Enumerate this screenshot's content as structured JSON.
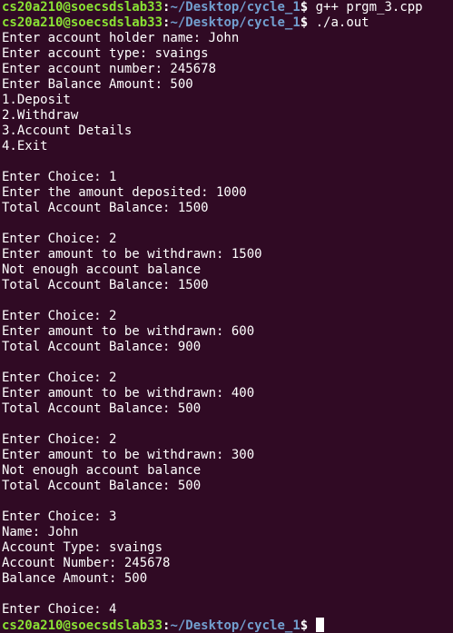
{
  "prompt": {
    "user_host": "cs20a210@soecsdslab33",
    "colon": ":",
    "path": "~/Desktop/cycle_1",
    "symbol": "$ "
  },
  "commands": [
    "g++ prgm_3.cpp",
    "./a.out"
  ],
  "output_lines": [
    "Enter account holder name: John",
    "Enter account type: svaings",
    "Enter account number: 245678",
    "Enter Balance Amount: 500",
    "1.Deposit",
    "2.Withdraw",
    "3.Account Details",
    "4.Exit",
    "",
    "Enter Choice: 1",
    "Enter the amount deposited: 1000",
    "Total Account Balance: 1500",
    "",
    "Enter Choice: 2",
    "Enter amount to be withdrawn: 1500",
    "Not enough account balance",
    "Total Account Balance: 1500",
    "",
    "Enter Choice: 2",
    "Enter amount to be withdrawn: 600",
    "Total Account Balance: 900",
    "",
    "Enter Choice: 2",
    "Enter amount to be withdrawn: 400",
    "Total Account Balance: 500",
    "",
    "Enter Choice: 2",
    "Enter amount to be withdrawn: 300",
    "Not enough account balance",
    "Total Account Balance: 500",
    "",
    "Enter Choice: 3",
    "Name: John",
    "Account Type: svaings",
    "Account Number: 245678",
    "Balance Amount: 500",
    "",
    "Enter Choice: 4"
  ],
  "colors": {
    "background": "#300a24",
    "user_host": "#8ae234",
    "path": "#729fcf",
    "text": "#ffffff"
  }
}
